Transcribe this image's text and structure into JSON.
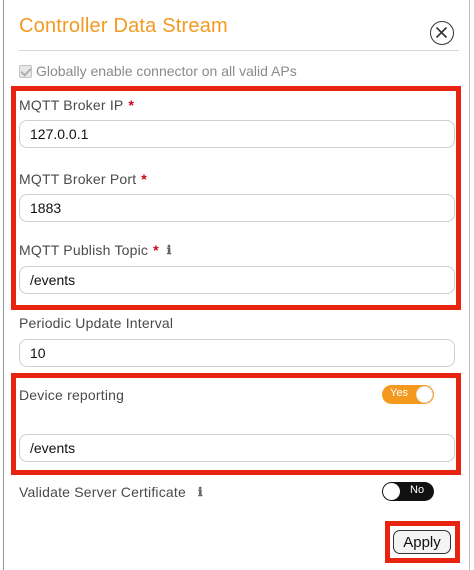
{
  "title": "Controller Data Stream",
  "global_enable": {
    "label": "Globally enable connector on all valid APs",
    "checked": true,
    "disabled": true
  },
  "fields": {
    "broker_ip": {
      "label": "MQTT Broker IP",
      "required_mark": "*",
      "value": "127.0.0.1"
    },
    "broker_port": {
      "label": "MQTT Broker Port",
      "required_mark": "*",
      "value": "1883"
    },
    "publish_topic": {
      "label": "MQTT Publish Topic",
      "required_mark": "*",
      "info_icon": "ℹ",
      "value": "/events"
    },
    "update_interval": {
      "label": "Periodic Update Interval",
      "value": "10"
    }
  },
  "device_reporting": {
    "label": "Device reporting",
    "toggle_text": "Yes",
    "enabled": true,
    "topic_value": "/events"
  },
  "validate_cert": {
    "label": "Validate Server Certificate",
    "info_icon": "ℹ",
    "toggle_text": "No",
    "enabled": false
  },
  "apply_label": "Apply",
  "colors": {
    "title": "#f39a1e",
    "toggle_on": "#f39a1e",
    "toggle_off": "#111111",
    "highlight": "#e8230f",
    "required": "#d0021b"
  },
  "icons": {
    "close": "close-circle-icon",
    "info": "info-icon",
    "checkbox": "checkmark-icon"
  }
}
